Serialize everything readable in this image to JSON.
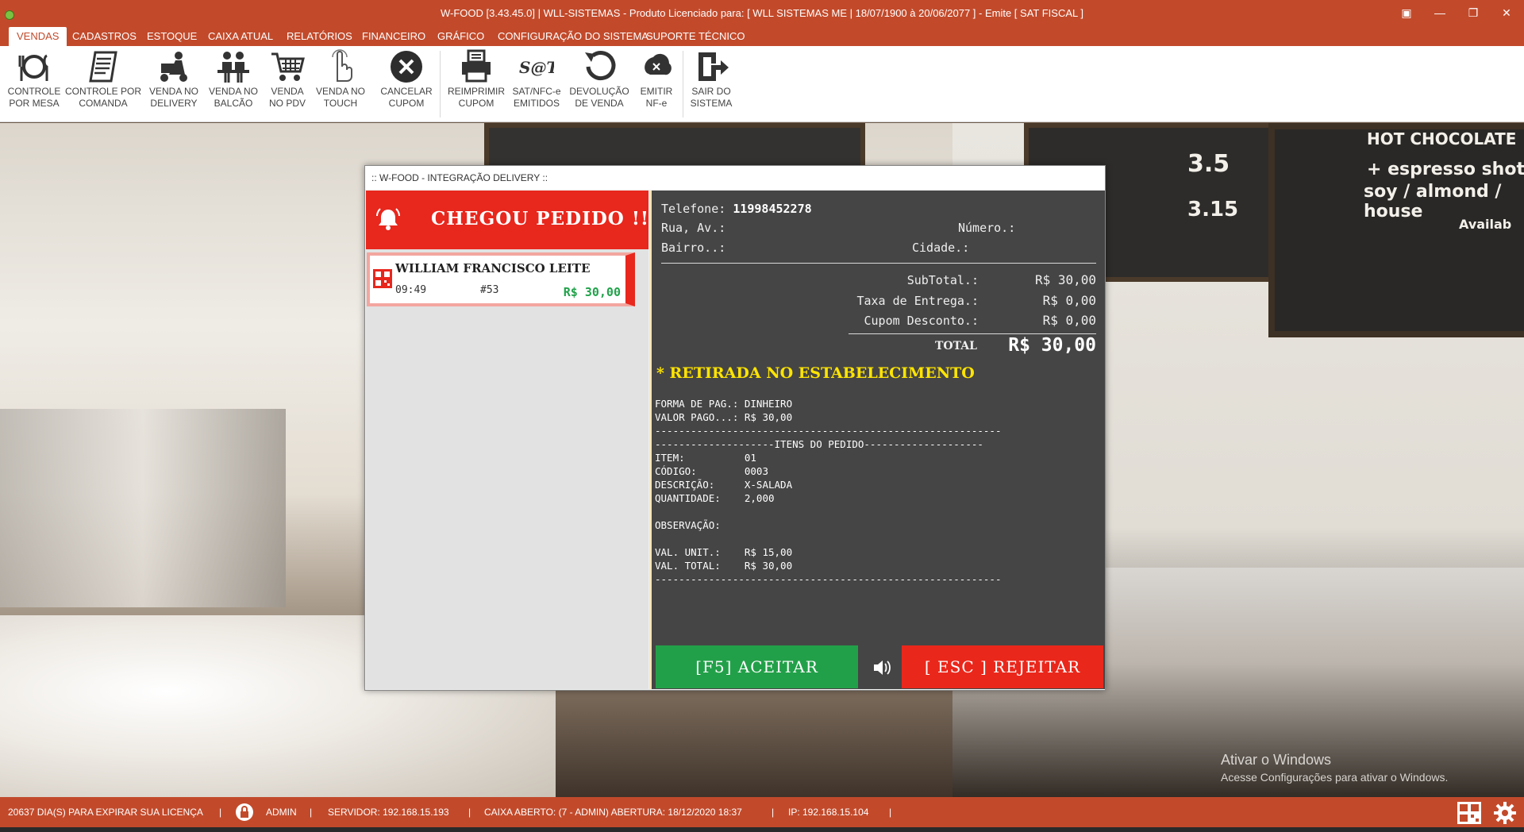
{
  "window": {
    "title": "W-FOOD [3.43.45.0] | WLL-SISTEMAS - Produto Licenciado para:  [ WLL SISTEMAS ME | 18/07/1900 à 20/06/2077 ]  - Emite [ SAT FISCAL ]"
  },
  "menu": {
    "tabs": [
      "VENDAS",
      "CADASTROS",
      "ESTOQUE",
      "CAIXA ATUAL",
      "RELATÓRIOS",
      "FINANCEIRO",
      "GRÁFICO",
      "CONFIGURAÇÃO DO SISTEMA",
      "SUPORTE TÉCNICO"
    ],
    "active": "VENDAS"
  },
  "ribbon": {
    "buttons": [
      {
        "l1": "CONTROLE",
        "l2": "POR MESA",
        "icon": "table-dining-icon"
      },
      {
        "l1": "CONTROLE POR",
        "l2": "COMANDA",
        "icon": "order-pad-icon"
      },
      {
        "l1": "VENDA NO",
        "l2": "DELIVERY",
        "icon": "delivery-scooter-icon"
      },
      {
        "l1": "VENDA NO",
        "l2": "BALCÃO",
        "icon": "counter-people-icon"
      },
      {
        "l1": "VENDA",
        "l2": "NO PDV",
        "icon": "shopping-cart-icon"
      },
      {
        "l1": "VENDA NO",
        "l2": "TOUCH",
        "icon": "touch-hand-icon"
      },
      {
        "l1": "CANCELAR",
        "l2": "CUPOM",
        "icon": "cancel-circle-icon"
      },
      {
        "l1": "REIMPRIMIR",
        "l2": "CUPOM",
        "icon": "printer-icon"
      },
      {
        "l1": "SAT/NFC-e",
        "l2": "EMITIDOS",
        "icon": "sat-logo-icon",
        "logo_text": "S@T"
      },
      {
        "l1": "DEVOLUÇÃO",
        "l2": "DE VENDA",
        "icon": "return-arrow-icon"
      },
      {
        "l1": "EMITIR",
        "l2": "NF-e",
        "icon": "nfe-icon"
      },
      {
        "l1": "SAIR DO",
        "l2": "SISTEMA",
        "icon": "exit-door-icon"
      }
    ]
  },
  "background": {
    "board_texts": [
      "HOT CHOCOLATE",
      "+ espresso shot",
      "soy / almond / house",
      "Availab",
      "3.5",
      "3.15"
    ],
    "watermark_title": "Ativar o Windows",
    "watermark_sub": "Acesse Configurações para ativar o Windows."
  },
  "dialog": {
    "title": ":: W-FOOD - INTEGRAÇÃO DELIVERY ::",
    "alert_text": "CHEGOU PEDIDO !!!",
    "order": {
      "customer": "WILLIAM FRANCISCO LEITE",
      "time": "09:49",
      "number": "#53",
      "total": "R$ 30,00"
    },
    "details": {
      "phone_label": "Telefone:",
      "phone": "11998452278",
      "street_label": "Rua, Av.:",
      "number_label": "Número.:",
      "district_label": "Bairro..:",
      "city_label": "Cidade.:",
      "subtotal_label": "SubTotal.:",
      "subtotal": "R$ 30,00",
      "delivery_fee_label": "Taxa de Entrega.:",
      "delivery_fee": "R$ 0,00",
      "discount_label": "Cupom Desconto.:",
      "discount": "R$ 0,00",
      "total_label": "TOTAL",
      "total": "R$ 30,00",
      "pickup": "* RETIRADA NO ESTABELECIMENTO"
    },
    "receipt": "FORMA DE PAG.: DINHEIRO\nVALOR PAGO...: R$ 30,00\n----------------------------------------------------------\n--------------------ITENS DO PEDIDO--------------------\nITEM:          01\nCÓDIGO:        0003\nDESCRIÇÃO:     X-SALADA\nQUANTIDADE:    2,000\n\nOBSERVAÇÃO:\n\nVAL. UNIT.:    R$ 15,00\nVAL. TOTAL:    R$ 30,00\n----------------------------------------------------------",
    "accept_label": "[F5] ACEITAR",
    "reject_label": "[ ESC ] REJEITAR"
  },
  "status": {
    "license": "20637 DIA(S) PARA EXPIRAR SUA LICENÇA",
    "user": "ADMIN",
    "server": "SERVIDOR: 192.168.15.193",
    "cashier": "CAIXA ABERTO: (7 - ADMIN) ABERTURA: 18/12/2020 18:37",
    "ip": "IP: 192.168.15.104",
    "sep": "|"
  },
  "colors": {
    "brand": "#c24a2b",
    "alert_red": "#e8271d",
    "accept_green": "#22a049",
    "pickup_yellow": "#ffe400",
    "panel_dark": "#454545"
  }
}
